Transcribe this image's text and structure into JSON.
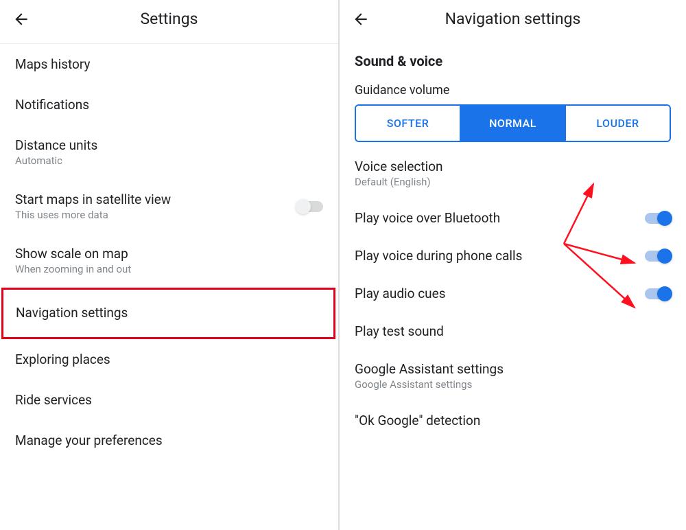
{
  "left": {
    "title": "Settings",
    "items": [
      {
        "title": "Maps history"
      },
      {
        "title": "Notifications"
      },
      {
        "title": "Distance units",
        "sub": "Automatic"
      },
      {
        "title": "Start maps in satellite view",
        "sub": "This uses more data",
        "toggle": "off"
      },
      {
        "title": "Show scale on map",
        "sub": "When zooming in and out"
      },
      {
        "title": "Navigation settings",
        "highlight": true
      },
      {
        "title": "Exploring places"
      },
      {
        "title": "Ride services"
      },
      {
        "title": "Manage your preferences"
      }
    ]
  },
  "right": {
    "title": "Navigation settings",
    "section": "Sound & voice",
    "guidance_label": "Guidance volume",
    "segments": {
      "softer": "SOFTER",
      "normal": "NORMAL",
      "louder": "LOUDER",
      "selected": "normal"
    },
    "voice_selection": {
      "title": "Voice selection",
      "sub": "Default (English)"
    },
    "bluetooth": {
      "title": "Play voice over Bluetooth",
      "toggle": "on"
    },
    "phone_calls": {
      "title": "Play voice during phone calls",
      "toggle": "on"
    },
    "audio_cues": {
      "title": "Play audio cues",
      "toggle": "on"
    },
    "test_sound": {
      "title": "Play test sound"
    },
    "assistant": {
      "title": "Google Assistant settings",
      "sub": "Google Assistant settings"
    },
    "ok_google": {
      "title": "\"Ok Google\" detection"
    }
  }
}
